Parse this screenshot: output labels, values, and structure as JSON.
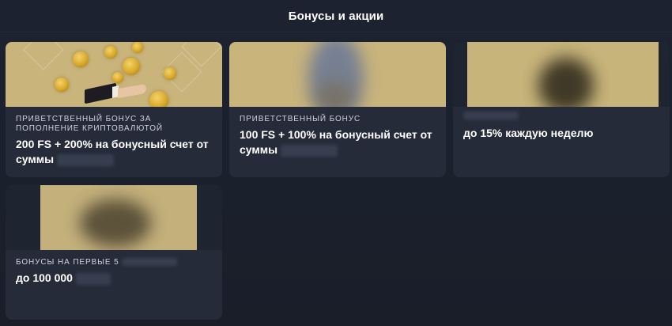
{
  "header": {
    "title": "Бонусы и акции"
  },
  "cards": [
    {
      "label": "Приветственный бонус за пополнение криптовалютой",
      "title": "200 FS + 200% на бонусный счет от суммы"
    },
    {
      "label": "Приветственный бонус",
      "title": "100 FS + 100% на бонусный счет от суммы"
    },
    {
      "label": "",
      "title": "до 15% каждую неделю"
    },
    {
      "label": "Бонусы на первые 5",
      "title": "до 100 000"
    }
  ],
  "colors": {
    "background": "#1a1f2b",
    "card": "#252b39",
    "image_gold": "#c9b47c"
  }
}
